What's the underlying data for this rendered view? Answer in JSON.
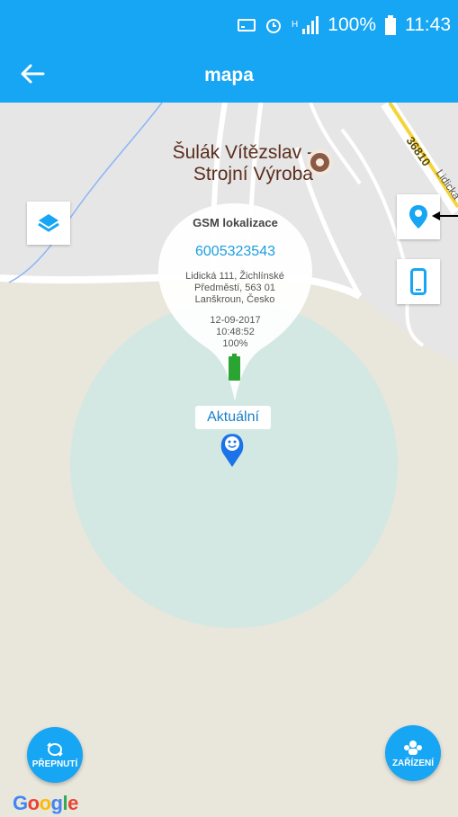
{
  "status_bar": {
    "battery": "100%",
    "time": "11:43"
  },
  "app_bar": {
    "title": "mapa"
  },
  "map": {
    "poi": {
      "name": "Šulák Vítězslav - Strojní Výroba"
    },
    "road": {
      "number": "36810",
      "name": "Lidická"
    },
    "info_window": {
      "title": "GSM lokalizace",
      "phone": "6005323543",
      "address": "Lidická 111, Žichlínské Předměstí, 563 01 Lanškroun, Česko",
      "date": "12-09-2017",
      "time": "10:48:52",
      "battery": "100%"
    },
    "current_label": "Aktuální",
    "attribution": "Google"
  },
  "controls": {
    "layers_icon": "layers-icon",
    "location_icon": "location-pin-icon",
    "device_icon": "phone-icon"
  },
  "fab": {
    "switch_label": "PŘEPNUTÍ",
    "devices_label": "ZAŘÍZENÍ"
  },
  "colors": {
    "primary": "#16a6f3",
    "accuracy_circle": "#cfe8e4",
    "battery": "#2aa532"
  }
}
